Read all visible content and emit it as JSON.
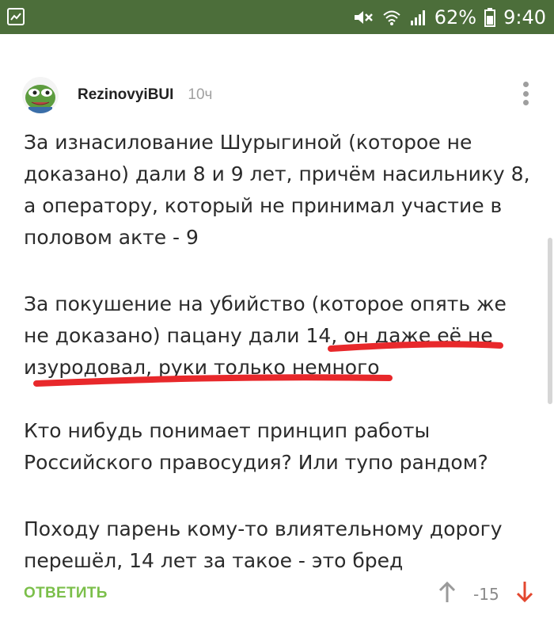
{
  "status_bar": {
    "battery": "62%",
    "time": "9:40",
    "icons": [
      "gallery-icon",
      "mute-icon",
      "wifi-icon",
      "signal-icon",
      "battery-icon"
    ],
    "background": "#4c6e3a"
  },
  "comment": {
    "author": "RezinovyiBUI",
    "time_ago": "10ч",
    "paragraphs": {
      "p1": "За изнасилование Шурыгиной (которое не доказано) дали 8 и 9 лет, причём насильнику 8, а оператору, который не принимал участие в половом акте - 9",
      "p2_line1": "За покушение на убийство (которое опять же",
      "p2_line2": "не доказано) пацану дали 14, он даже её не",
      "p2_line3": "изуродовал, руки только немного",
      "p3": "Кто нибудь понимает принцип работы Российского правосудия? Или тупо рандом?",
      "p4": "Походу парень кому-то влиятельному дорогу перешёл, 14 лет за такое - это бред"
    },
    "annotation_color": "#e8282b"
  },
  "actions": {
    "reply_label": "ОТВЕТИТЬ",
    "rating": "-15",
    "reply_color": "#7bbf4a",
    "downvote_color": "#e3472f"
  }
}
